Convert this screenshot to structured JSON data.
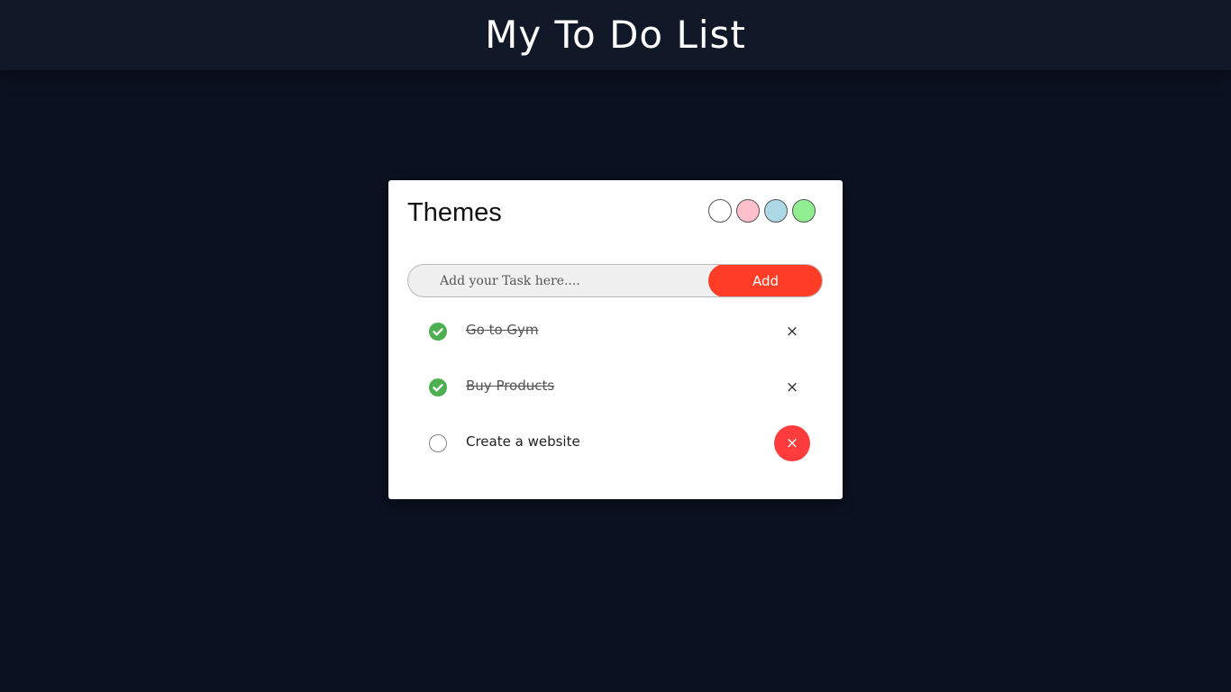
{
  "header": {
    "title": "My To Do List"
  },
  "card": {
    "themes_label": "Themes",
    "theme_swatches": [
      {
        "name": "white",
        "color": "#ffffff"
      },
      {
        "name": "pink",
        "color": "#ffc0cb"
      },
      {
        "name": "light-blue",
        "color": "#add8e6"
      },
      {
        "name": "light-green",
        "color": "#90ee90"
      }
    ],
    "input": {
      "placeholder": "Add your Task here....",
      "value": ""
    },
    "add_label": "Add",
    "tasks": [
      {
        "text": "Go to Gym",
        "done": true,
        "delete_label": "×"
      },
      {
        "text": "Buy Products",
        "done": true,
        "delete_label": "×"
      },
      {
        "text": "Create a website",
        "done": false,
        "delete_label": "×"
      }
    ]
  },
  "colors": {
    "background": "#0b1120",
    "header_bg": "#111827",
    "accent": "#ff3d26",
    "done_check": "#4caf50",
    "delete_hover": "#ff3c3c"
  }
}
